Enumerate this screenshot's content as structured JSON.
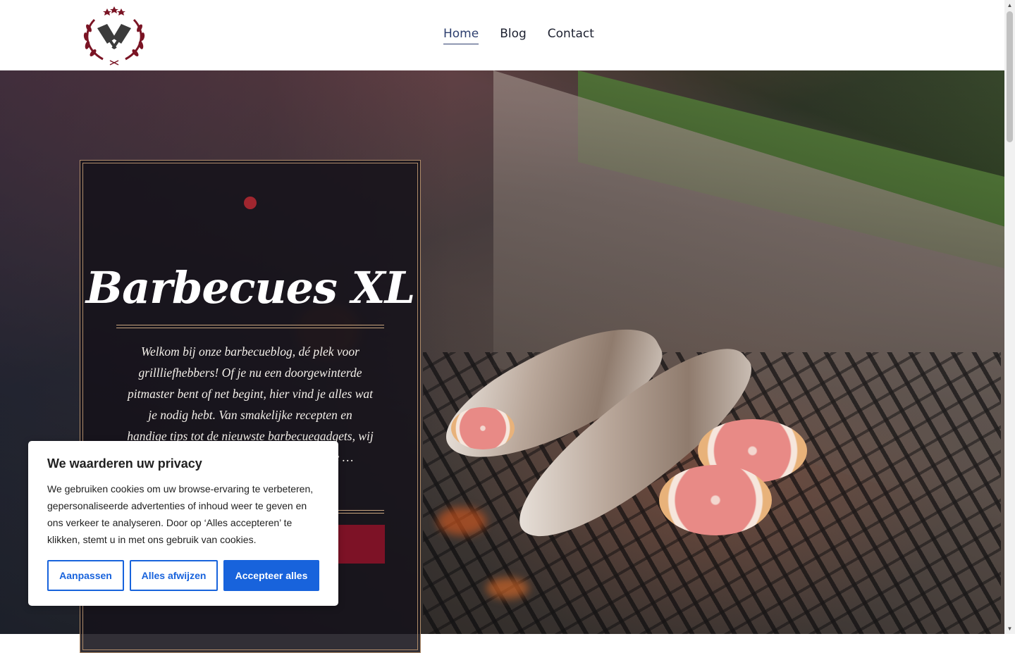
{
  "brand": {
    "logo_icon": "crossed-cleavers-laurel-icon",
    "accent": "#7d1226"
  },
  "nav": {
    "items": [
      {
        "label": "Home",
        "active": true
      },
      {
        "label": "Blog",
        "active": false
      },
      {
        "label": "Contact",
        "active": false
      }
    ]
  },
  "hero": {
    "title": "Barbecues XL",
    "intro": "Welkom bij onze barbecueblog, dé plek voor grillliefhebbers! Of je nu een doorgewinterde pitmaster bent of net begint, hier vind je alles wat je nodig hebt. Van smakelijke recepten en handige tips tot de nieuwste barbecuegadgets, wij helpen je om van elke grillsessie een te …",
    "cta_label": ""
  },
  "cookie": {
    "title": "We waarderen uw privacy",
    "body": "We gebruiken cookies om uw browse-ervaring te verbeteren, gepersonaliseerde advertenties of inhoud weer te geven en ons verkeer te analyseren. Door op ‘Alles accepteren’ te klikken, stemt u in met ons gebruik van cookies.",
    "customize_label": "Aanpassen",
    "reject_label": "Alles afwijzen",
    "accept_label": "Accepteer alles",
    "button_color": "#1863dc"
  }
}
